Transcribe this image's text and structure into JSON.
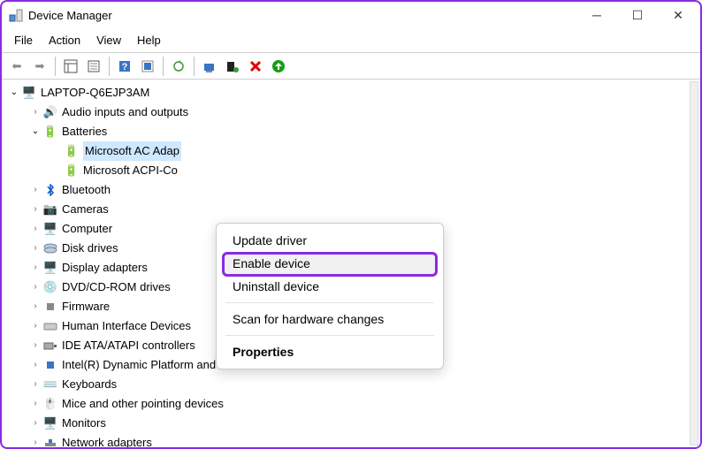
{
  "window": {
    "title": "Device Manager"
  },
  "menu": {
    "file": "File",
    "action": "Action",
    "view": "View",
    "help": "Help"
  },
  "root": {
    "name": "LAPTOP-Q6EJP3AM"
  },
  "tree": {
    "audio": "Audio inputs and outputs",
    "batteries": "Batteries",
    "bat1": "Microsoft AC Adap",
    "bat2": "Microsoft ACPI-Co",
    "bluetooth": "Bluetooth",
    "cameras": "Cameras",
    "computer": "Computer",
    "disk": "Disk drives",
    "display": "Display adapters",
    "dvd": "DVD/CD-ROM drives",
    "firmware": "Firmware",
    "hid": "Human Interface Devices",
    "ide": "IDE ATA/ATAPI controllers",
    "intel": "Intel(R) Dynamic Platform and Thermal Framework",
    "keyboards": "Keyboards",
    "mice": "Mice and other pointing devices",
    "monitors": "Monitors",
    "network": "Network adapters"
  },
  "context": {
    "update": "Update driver",
    "enable": "Enable device",
    "uninstall": "Uninstall device",
    "scan": "Scan for hardware changes",
    "properties": "Properties"
  }
}
